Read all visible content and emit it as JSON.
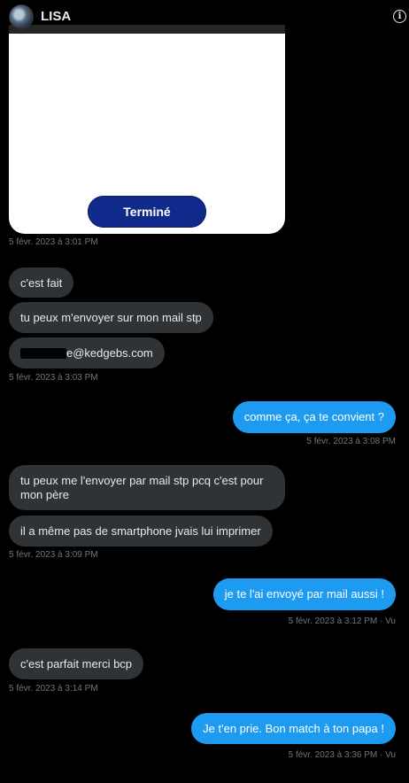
{
  "header": {
    "title": "LISA"
  },
  "card": {
    "button_label": "Terminé"
  },
  "messages": {
    "m1_time": "5 févr. 2023 à 3:01 PM",
    "m2": "c'est fait",
    "m3": "tu peux m'envoyer sur mon mail stp",
    "m4": "e@kedgebs.com",
    "m4_time": "5 févr. 2023 à 3:03 PM",
    "m5": "comme ça, ça te convient ?",
    "m5_time": "5 févr. 2023 à 3:08 PM",
    "m6": "tu peux me l'envoyer par mail stp pcq c'est pour mon père",
    "m7": "il a même pas de smartphone jvais lui imprimer",
    "m7_time": "5 févr. 2023 à 3:09 PM",
    "m8": "je te l'ai envoyé par mail aussi !",
    "m8_time": "5 févr. 2023 à 3:12 PM · Vu",
    "m9": "c'est parfait merci bcp",
    "m9_time": "5 févr. 2023 à 3:14 PM",
    "m10": "Je t'en prie. Bon match à ton papa !",
    "m10_time": "5 févr. 2023 à 3:36 PM · Vu"
  }
}
